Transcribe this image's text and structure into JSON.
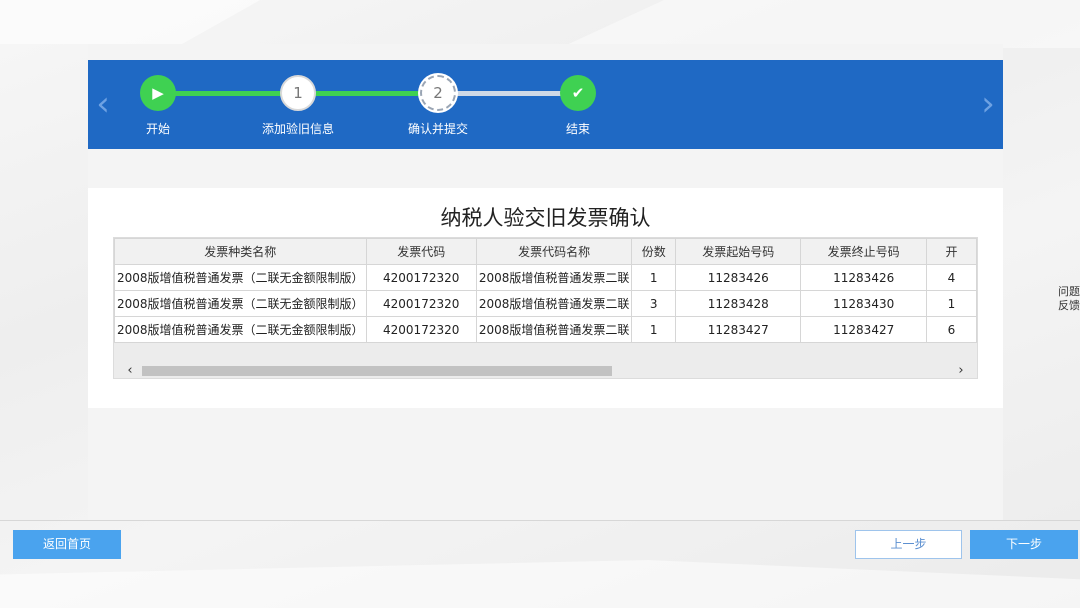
{
  "steps": [
    {
      "label": "开始",
      "marker": "▶",
      "state": "done"
    },
    {
      "label": "添加验旧信息",
      "marker": "1",
      "state": "completed"
    },
    {
      "label": "确认并提交",
      "marker": "2",
      "state": "current"
    },
    {
      "label": "结束",
      "marker": "✔",
      "state": "done"
    }
  ],
  "nav": {
    "prev_arrow": "‹",
    "next_arrow": "›"
  },
  "card": {
    "title": "纳税人验交旧发票确认"
  },
  "table": {
    "headers": [
      "发票种类名称",
      "发票代码",
      "发票代码名称",
      "份数",
      "发票起始号码",
      "发票终止号码",
      "开"
    ],
    "rows": [
      [
        "2008版增值税普通发票（二联无金额限制版）",
        "4200172320",
        "2008版增值税普通发票二联",
        "1",
        "11283426",
        "11283426",
        "4"
      ],
      [
        "2008版增值税普通发票（二联无金额限制版）",
        "4200172320",
        "2008版增值税普通发票二联",
        "3",
        "11283428",
        "11283430",
        "1"
      ],
      [
        "2008版增值税普通发票（二联无金额限制版）",
        "4200172320",
        "2008版增值税普通发票二联",
        "1",
        "11283427",
        "11283427",
        "6"
      ]
    ],
    "scroll_left": "‹",
    "scroll_right": "›"
  },
  "side": {
    "feedback_line1": "问题",
    "feedback_line2": "反馈"
  },
  "footer": {
    "home_label": "返回首页",
    "prev_label": "上一步",
    "next_label": "下一步"
  },
  "colors": {
    "banner": "#1f69c4",
    "progress_done": "#3fd152",
    "button_primary": "#4aa3ee"
  }
}
